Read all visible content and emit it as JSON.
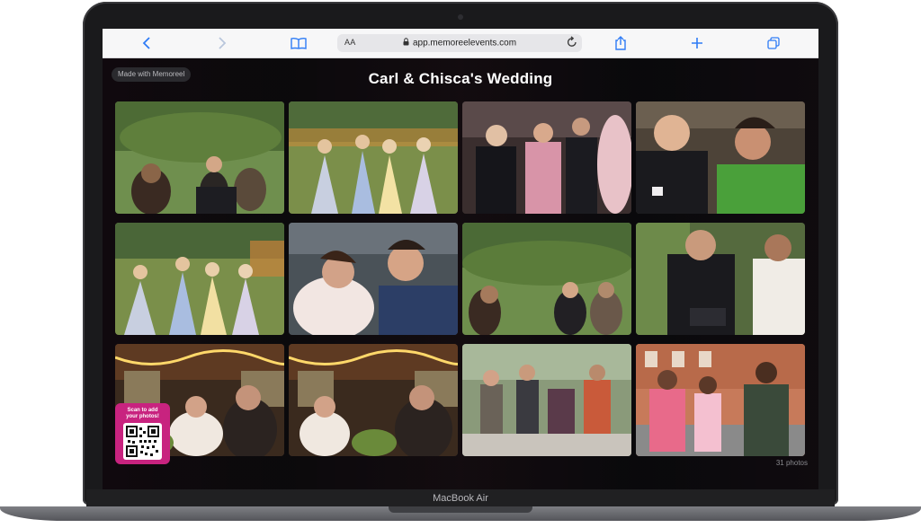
{
  "browser": {
    "aa_label": "AA",
    "url": "app.memoreelevents.com"
  },
  "page": {
    "badge": "Made with Memoreel",
    "title": "Carl & Chisca's Wedding",
    "qr_text_line1": "Scan to add",
    "qr_text_line2": "your photos!",
    "photo_count": "31 photos"
  },
  "device": {
    "brand": "MacBook Air"
  },
  "colors": {
    "accent_pink": "#c8237f",
    "title": "#ffffff"
  }
}
